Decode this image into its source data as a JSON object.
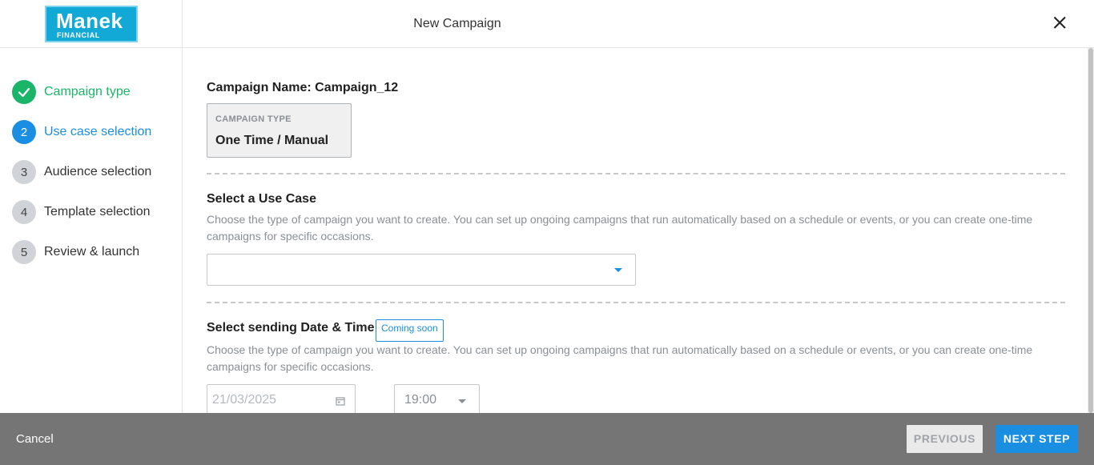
{
  "brand": {
    "logo_main": "Manek",
    "logo_sub": "FINANCIAL"
  },
  "header": {
    "title": "New Campaign",
    "close_icon": "close-icon"
  },
  "steps": [
    {
      "number": "1",
      "label": "Campaign type",
      "state": "done"
    },
    {
      "number": "2",
      "label": "Use case selection",
      "state": "active"
    },
    {
      "number": "3",
      "label": "Audience selection",
      "state": "pending"
    },
    {
      "number": "4",
      "label": "Template selection",
      "state": "pending"
    },
    {
      "number": "5",
      "label": "Review & launch",
      "state": "pending"
    }
  ],
  "campaign": {
    "name_label": "Campaign Name: Campaign_12",
    "type_caption": "CAMPAIGN TYPE",
    "type_value": "One Time / Manual"
  },
  "use_case": {
    "title": "Select a Use Case",
    "description": "Choose the type of campaign you want to create. You can set up ongoing campaigns that run automatically based on a schedule or events, or you can create one-time campaigns for specific occasions.",
    "selected": ""
  },
  "schedule": {
    "title": "Select sending Date & Time",
    "badge": "Coming soon",
    "description": "Choose the type of campaign you want to create. You can set up ongoing campaigns that run automatically based on a schedule or events, or you can create one-time campaigns for specific occasions.",
    "date": "21/03/2025",
    "time": "19:00"
  },
  "footer": {
    "cancel": "Cancel",
    "previous": "PREVIOUS",
    "next": "NEXT STEP"
  },
  "colors": {
    "accent": "#1a8ee0",
    "success": "#1bb56a",
    "footer_bg": "#757575",
    "logo_bg": "#12a9d6"
  }
}
